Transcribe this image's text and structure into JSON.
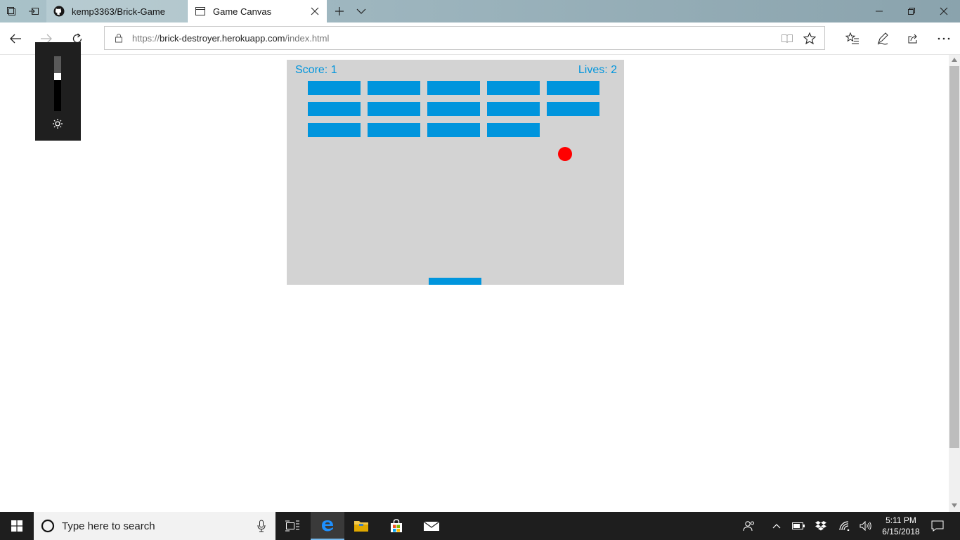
{
  "browser": {
    "tabs": [
      {
        "label": "kemp3363/Brick-Game",
        "active": false,
        "icon": "github-icon"
      },
      {
        "label": "Game Canvas",
        "active": true,
        "icon": "page-icon"
      }
    ],
    "address": {
      "url_scheme": "https://",
      "url_host": "brick-destroyer.herokuapp.com",
      "url_path": "/index.html"
    }
  },
  "game": {
    "score_text": "Score: 1",
    "lives_text": "Lives: 2",
    "colors": {
      "canvas": "#d3d3d3",
      "brick": "#0095dd",
      "ball": "#ff0000",
      "hud_text": "#0095dd"
    },
    "brick_grid": {
      "rows": 3,
      "columns": 5
    },
    "bricks_remaining": [
      [
        1,
        1,
        1,
        1,
        1
      ],
      [
        1,
        1,
        1,
        1,
        1
      ],
      [
        1,
        1,
        1,
        1,
        0
      ]
    ]
  },
  "brightness_flyout": {
    "level": 0.65
  },
  "taskbar": {
    "search_placeholder": "Type here to search",
    "time": "5:11 PM",
    "date": "6/15/2018"
  }
}
